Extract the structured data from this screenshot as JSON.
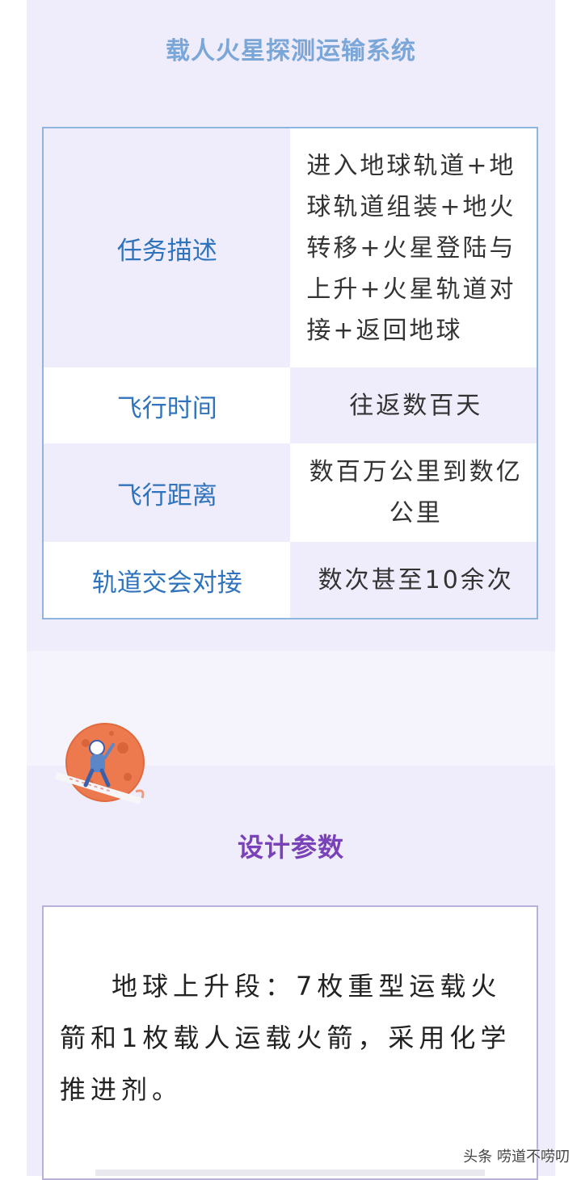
{
  "top_section": {
    "title": "载人火星探测运输系统",
    "table": {
      "rows": [
        {
          "label": "任务描述",
          "value": "进入地球轨道+地球轨道组装+地火转移+火星登陆与上升+火星轨道对接+返回地球"
        },
        {
          "label": "飞行时间",
          "value": "往返数百天"
        },
        {
          "label": "飞行距离",
          "value": "数百万公里到数亿公里"
        },
        {
          "label": "轨道交会对接",
          "value": "数次甚至10余次"
        }
      ]
    }
  },
  "bottom_section": {
    "icon": "mars-astronaut-icon",
    "title": "设计参数",
    "paragraph": "地球上升段：7枚重型运载火箭和1枚载人运载火箭，采用化学推进剂。"
  },
  "watermark": "头条 唠道不唠叨",
  "colors": {
    "lavender_bg": "#efecfb",
    "label_blue": "#2f73bd",
    "title_blue": "#7aa6d8",
    "title_purple": "#7a42b8",
    "table_border": "#8fb4de"
  }
}
